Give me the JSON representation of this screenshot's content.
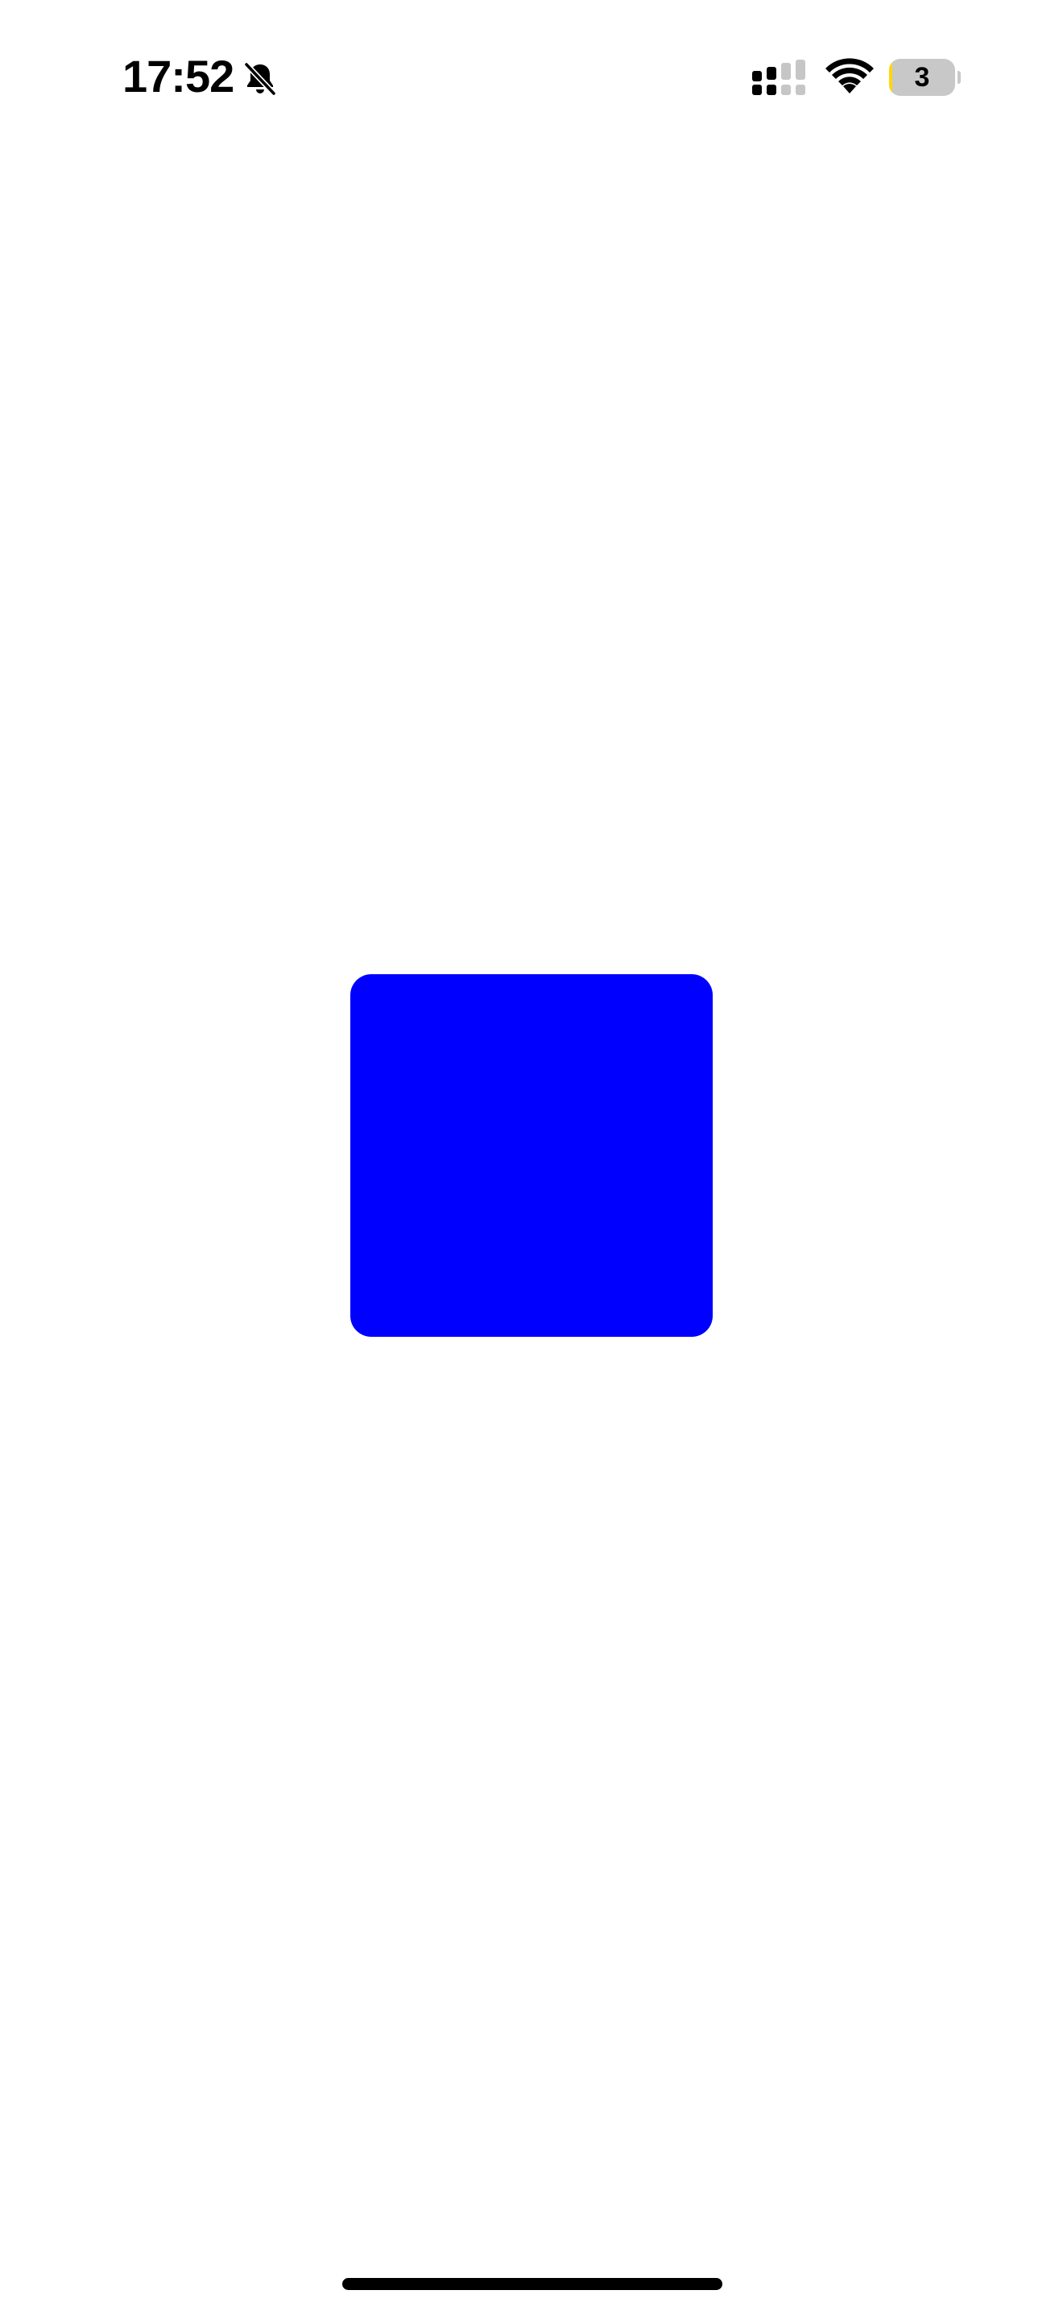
{
  "status_bar": {
    "time": "17:52",
    "silent_icon": "bell-slash-icon",
    "cellular_icon": "cellular-signal-icon",
    "wifi_icon": "wifi-icon",
    "battery_level": "3",
    "battery_fill_percent": 3
  },
  "content": {
    "square_color": "#0000ff"
  },
  "colors": {
    "background": "#ffffff",
    "battery_low": "#ffd60a",
    "battery_body": "#c8c8c8"
  }
}
